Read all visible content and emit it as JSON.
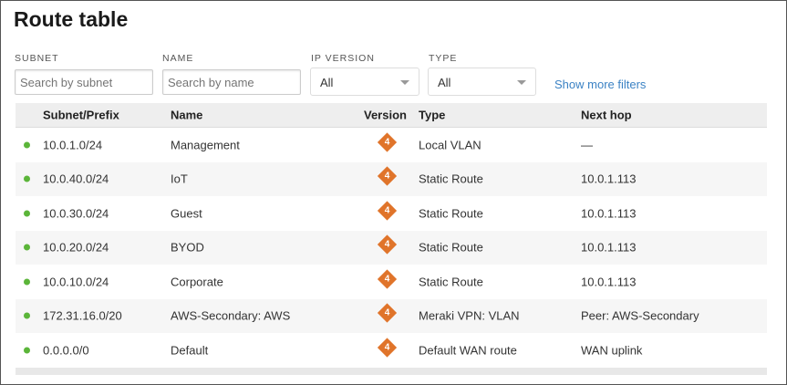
{
  "title": "Route table",
  "filters": {
    "subnet": {
      "label": "SUBNET",
      "placeholder": "Search by subnet"
    },
    "name": {
      "label": "NAME",
      "placeholder": "Search by name"
    },
    "ip_version": {
      "label": "IP VERSION",
      "value": "All"
    },
    "type": {
      "label": "TYPE",
      "value": "All"
    },
    "more": "Show more filters"
  },
  "columns": [
    "Subnet/Prefix",
    "Name",
    "Version",
    "Type",
    "Next hop"
  ],
  "rows": [
    {
      "subnet": "10.0.1.0/24",
      "name": "Management",
      "version": "4",
      "type": "Local VLAN",
      "next_hop": "—"
    },
    {
      "subnet": "10.0.40.0/24",
      "name": "IoT",
      "version": "4",
      "type": "Static Route",
      "next_hop": "10.0.1.113"
    },
    {
      "subnet": "10.0.30.0/24",
      "name": "Guest",
      "version": "4",
      "type": "Static Route",
      "next_hop": "10.0.1.113"
    },
    {
      "subnet": "10.0.20.0/24",
      "name": "BYOD",
      "version": "4",
      "type": "Static Route",
      "next_hop": "10.0.1.113"
    },
    {
      "subnet": "10.0.10.0/24",
      "name": "Corporate",
      "version": "4",
      "type": "Static Route",
      "next_hop": "10.0.1.113"
    },
    {
      "subnet": "172.31.16.0/20",
      "name": "AWS-Secondary: AWS",
      "version": "4",
      "type": "Meraki VPN: VLAN",
      "next_hop": "Peer: AWS-Secondary"
    },
    {
      "subnet": "0.0.0.0/0",
      "name": "Default",
      "version": "4",
      "type": "Default WAN route",
      "next_hop": "WAN uplink"
    }
  ]
}
